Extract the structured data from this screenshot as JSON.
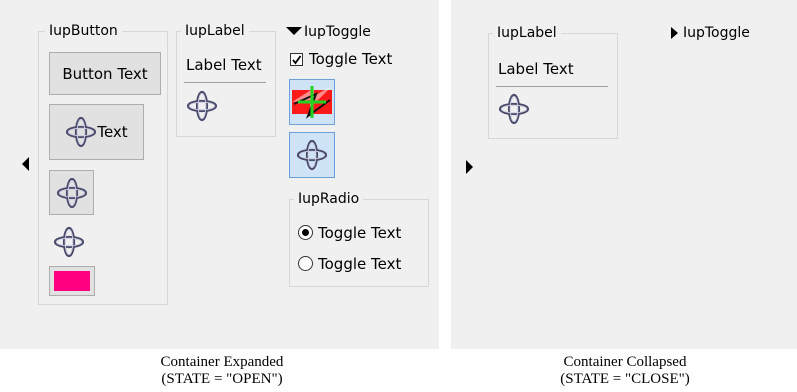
{
  "expanded": {
    "button_frame": {
      "title": "IupButton",
      "button_text": "Button Text",
      "image_text_button": "Text",
      "swatch_color": "#ff0080"
    },
    "label_frame": {
      "title": "IupLabel",
      "label_text": "Label Text"
    },
    "toggle": {
      "title": "IupToggle",
      "toggle_text": "Toggle Text",
      "checked": true
    },
    "radio_frame": {
      "title": "IupRadio",
      "options": [
        "Toggle Text",
        "Toggle Text"
      ],
      "selected_index": 0
    },
    "caption": [
      "Container Expanded",
      "(STATE = \"OPEN\")"
    ]
  },
  "collapsed": {
    "label_frame": {
      "title": "IupLabel",
      "label_text": "Label Text"
    },
    "toggle_title": "IupToggle",
    "caption": [
      "Container Collapsed",
      "(STATE = \"CLOSE\")"
    ]
  },
  "icons": {
    "gyro": "gyroscope-icon",
    "tecgraf": "tecgraf-logo-icon",
    "expand_left": "arrow-left-icon",
    "expand_right": "arrow-right-icon",
    "collapse_down": "arrow-down-icon"
  }
}
